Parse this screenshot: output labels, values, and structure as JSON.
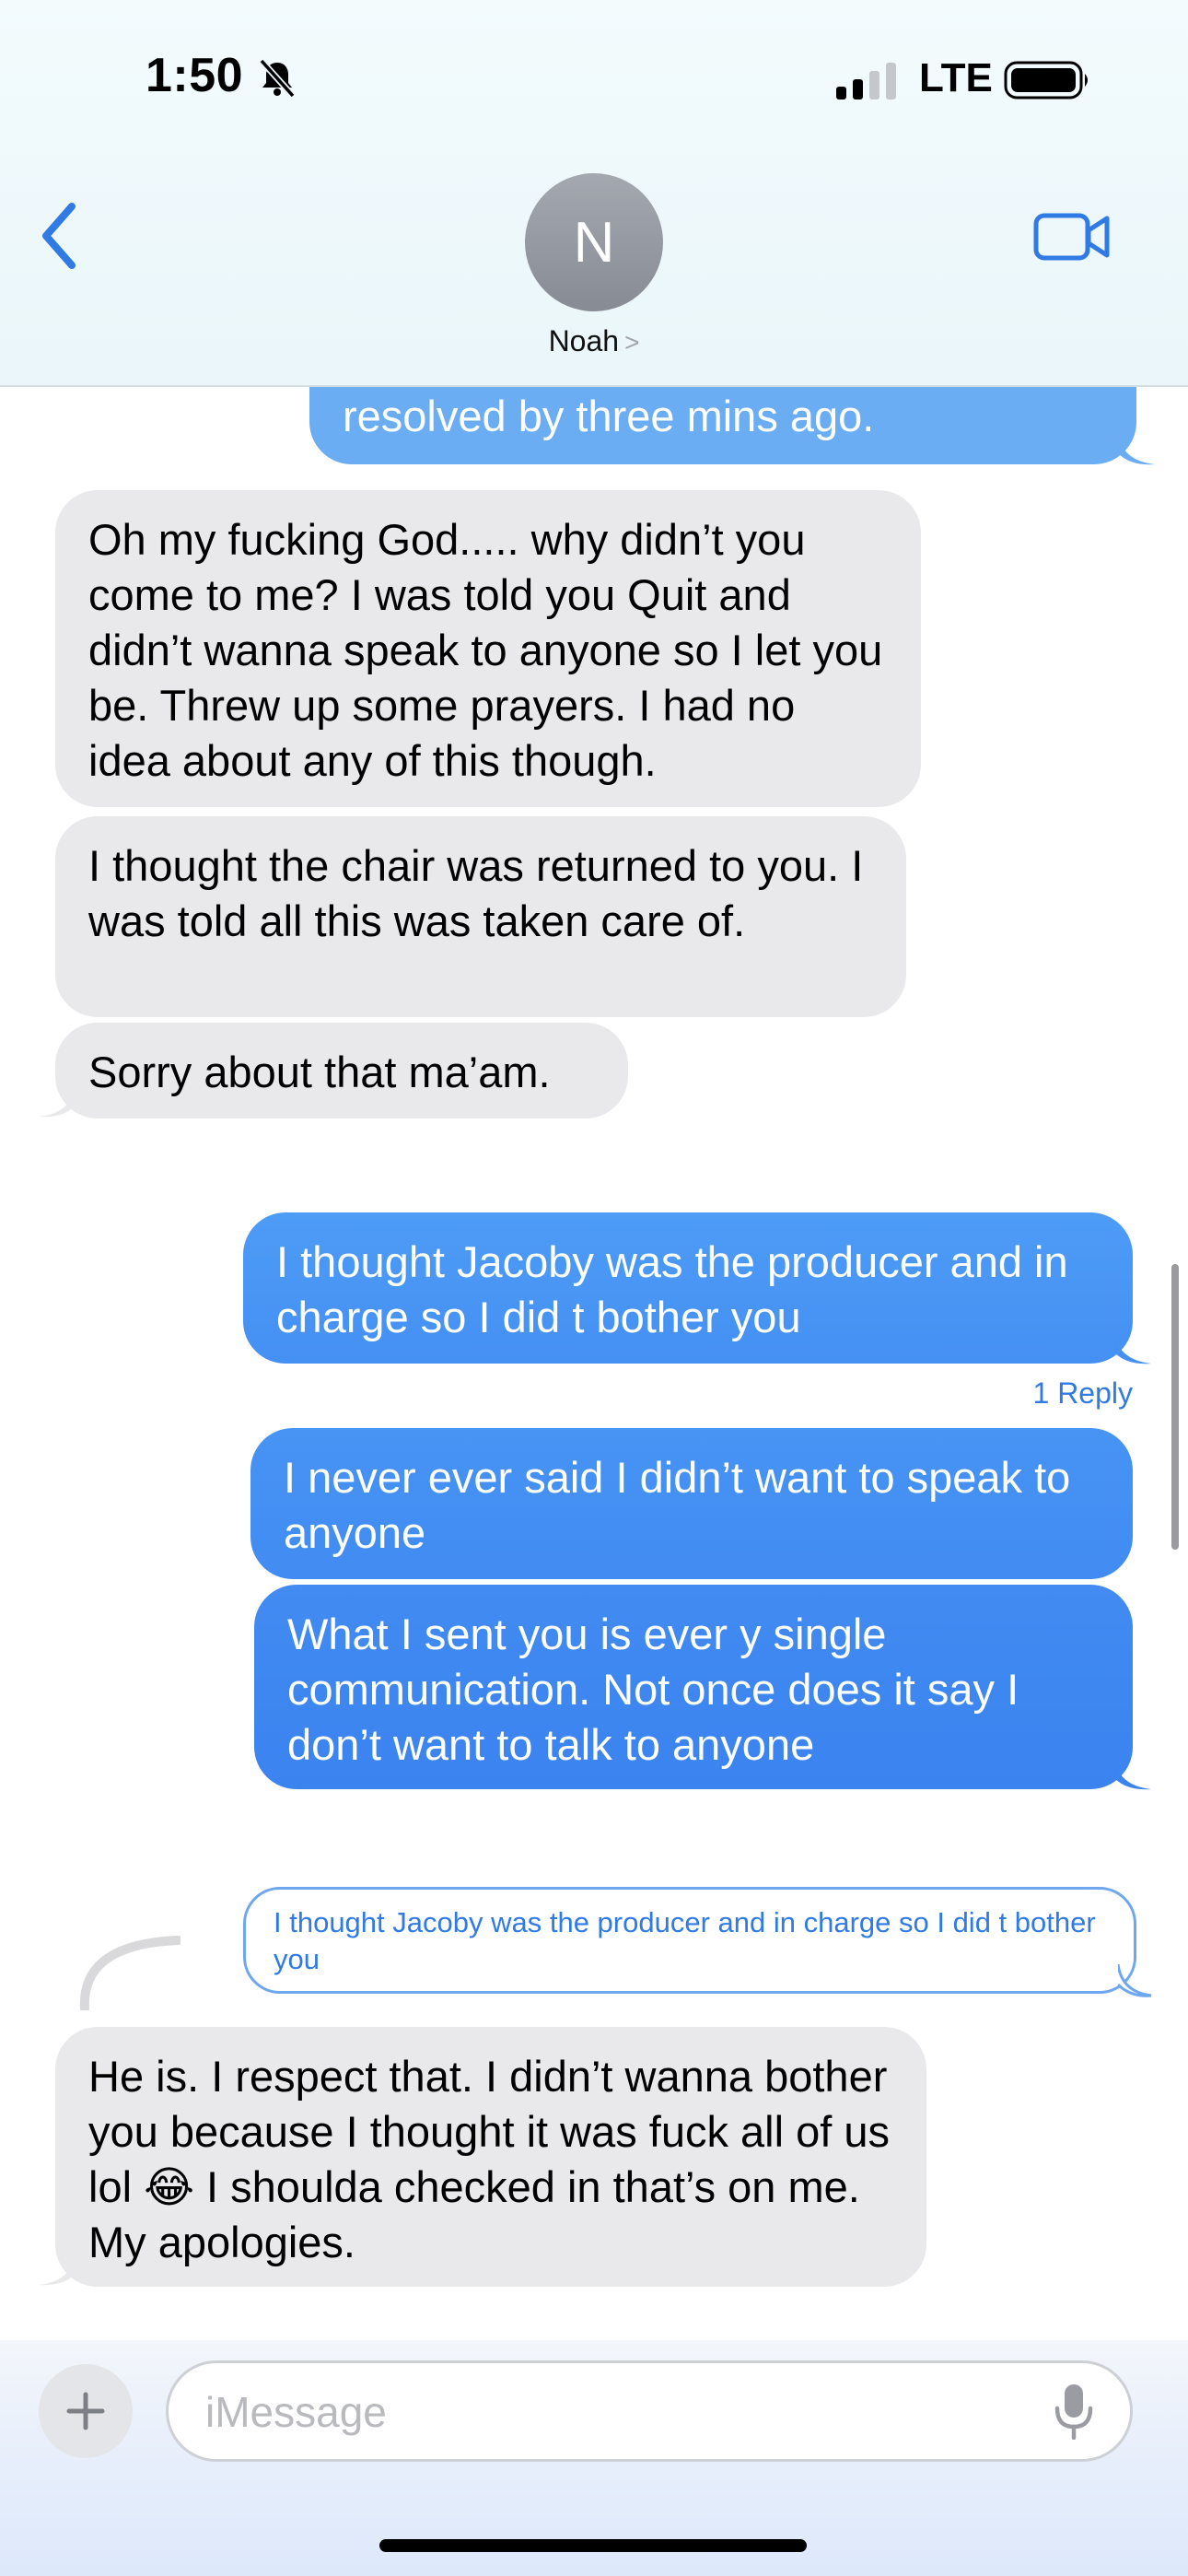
{
  "status_bar": {
    "time": "1:50",
    "carrier": "LTE",
    "signal_bars": 2
  },
  "header": {
    "avatar_initial": "N",
    "contact_name": "Noah",
    "name_chevron": ">"
  },
  "messages": [
    {
      "from": "me",
      "text": "resolved by three mins ago."
    },
    {
      "from": "them",
      "text": "Oh my fucking God..... why didn’t you come to me? I was told you Quit and didn’t wanna speak to anyone so I let you be. Threw up some prayers. I had no idea about any of this though."
    },
    {
      "from": "them",
      "text": "I thought the chair was returned to you. I was told all this was taken care of."
    },
    {
      "from": "them",
      "text": "Sorry about that ma’am."
    },
    {
      "from": "me",
      "text": "I thought Jacoby was the producer and in charge so I did t bother you"
    },
    {
      "from": "me",
      "text": "I never ever said I didn’t want to speak to anyone"
    },
    {
      "from": "me",
      "text": "What I sent you is ever y single communication. Not once does it say I don’t want to talk to anyone"
    },
    {
      "from": "them",
      "text": "He is. I respect that. I didn’t wanna bother you because I thought it was fuck all of us lol 😂 I shoulda checked in that’s on me. My apologies."
    }
  ],
  "thread": {
    "reply_count_label": "1 Reply",
    "quoted_text": "I thought Jacoby was the producer and in charge so I did t bother you"
  },
  "composer": {
    "placeholder": "iMessage"
  },
  "colors": {
    "accent_blue": "#2f7ae5",
    "outgoing_bubble_top": "#4a9bf6",
    "outgoing_bubble_bottom": "#3d84f0",
    "incoming_bubble": "#e9e9eb"
  },
  "icons": [
    "bell-slash-icon",
    "signal-icon",
    "battery-icon",
    "chevron-left-icon",
    "video-camera-icon",
    "plus-icon",
    "microphone-icon"
  ]
}
